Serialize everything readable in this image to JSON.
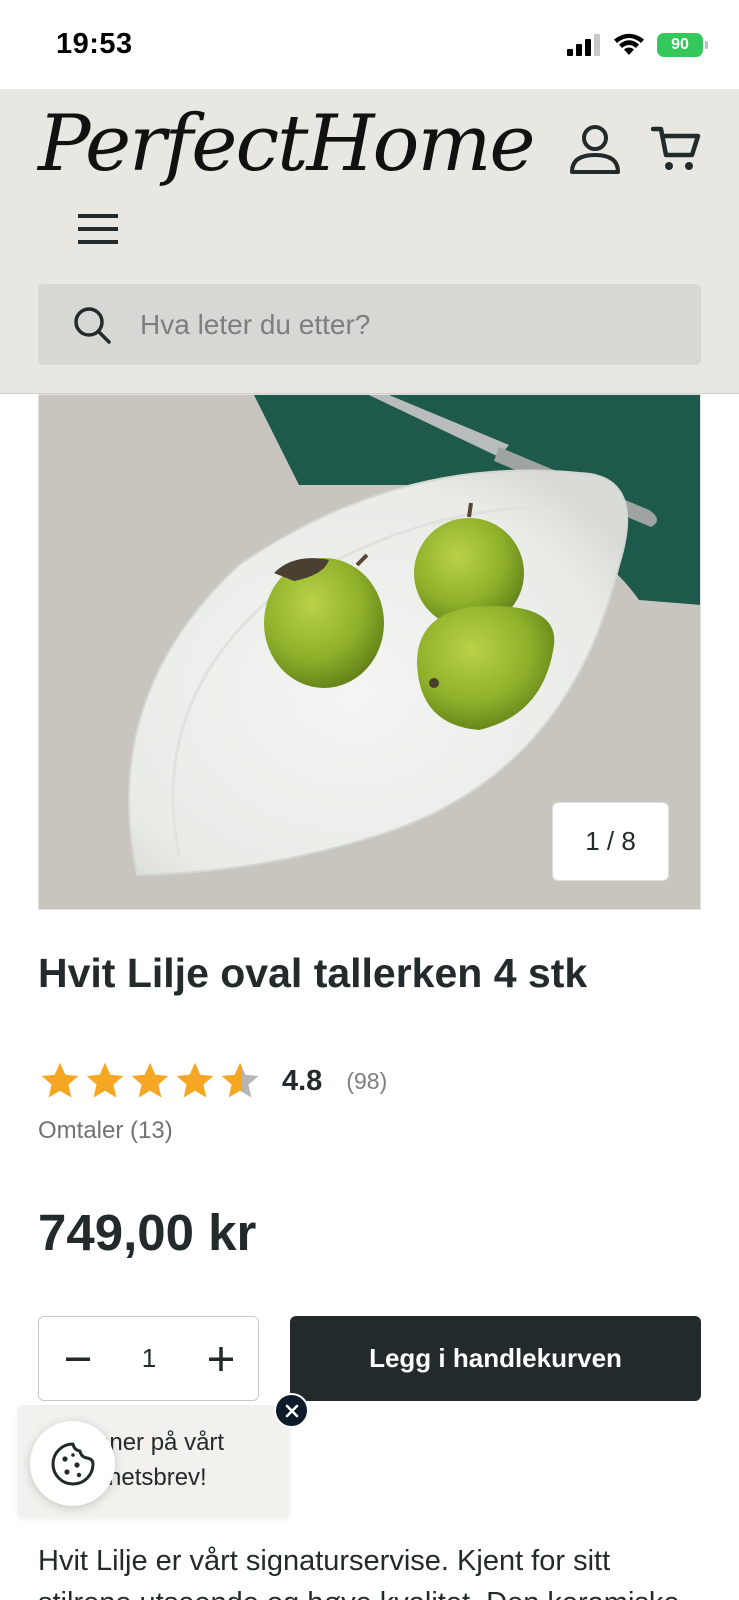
{
  "status_bar": {
    "time": "19:53",
    "battery": "90"
  },
  "header": {
    "logo_text_1": "Perfect",
    "logo_text_2": "Home",
    "account_icon": "user-icon",
    "cart_icon": "cart-icon",
    "menu_icon": "hamburger-menu-icon",
    "search": {
      "placeholder": "Hva leter du etter?",
      "icon": "search-icon"
    }
  },
  "gallery": {
    "counter": "1 / 8"
  },
  "product": {
    "title": "Hvit Lilje oval tallerken 4 stk",
    "rating": {
      "stars_out_of_5": 4.8,
      "value": "4.8",
      "count": "(98)"
    },
    "reviews_link": "Omtaler (13)",
    "price": "749,00 kr",
    "quantity": "1",
    "add_to_cart_label": "Legg i handlekurven"
  },
  "newsletter": {
    "text": "Ønsker du å vinner på vårt nyhetsbrev!",
    "visible_text": "nner på vårt\nyhetsbrev!"
  },
  "description": {
    "text": "Hvit Lilje er vårt signaturservise. Kjent for sitt stilrene utseende og høye kvalitet. Den keramiske"
  },
  "colors": {
    "header_bg": "#e8e7e2",
    "search_bg": "#d7d7d3",
    "primary_dark": "#232a2b",
    "star_gold": "#f5a623",
    "star_grey": "#b5b5b5",
    "battery_green": "#34c759"
  }
}
